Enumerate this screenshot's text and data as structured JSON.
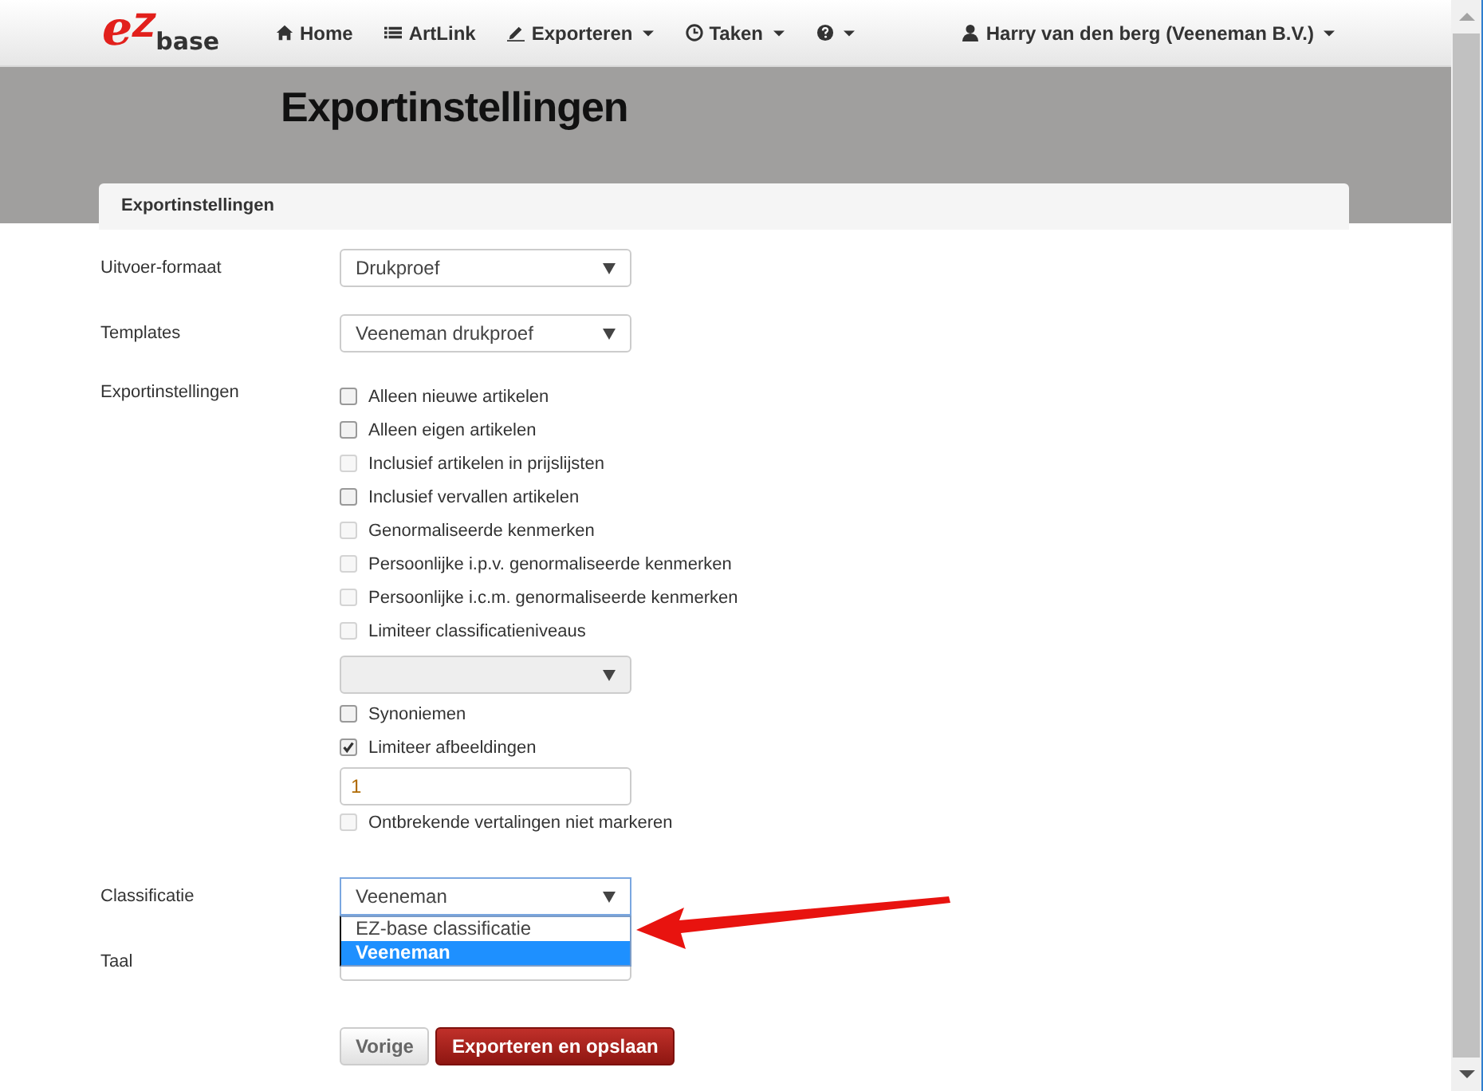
{
  "navbar": {
    "logo": {
      "letter_1": "e",
      "letter_2": "Z",
      "word": "base"
    },
    "items": [
      {
        "label": "Home",
        "dropdown": false
      },
      {
        "label": "ArtLink",
        "dropdown": false
      },
      {
        "label": "Exporteren",
        "dropdown": true
      },
      {
        "label": "Taken",
        "dropdown": true
      },
      {
        "dropdown": true
      }
    ],
    "user": {
      "label": "Harry van den berg (Veeneman B.V.)",
      "dropdown": true
    }
  },
  "page_title": "Exportinstellingen",
  "panel": {
    "heading": "Exportinstellingen",
    "fields": [
      {
        "kind": "select",
        "label": "Uitvoer-formaat",
        "value": "Drukproef"
      },
      {
        "kind": "select",
        "label": "Templates",
        "value": "Veeneman drukproef"
      },
      {
        "kind": "group",
        "label": "Exportinstellingen",
        "items": [
          {
            "kind": "checkbox",
            "label": "Alleen nieuwe artikelen",
            "checked": false,
            "disabled": false
          },
          {
            "kind": "checkbox",
            "label": "Alleen eigen artikelen",
            "checked": false,
            "disabled": false
          },
          {
            "kind": "checkbox",
            "label": "Inclusief artikelen in prijslijsten",
            "checked": false,
            "disabled": true
          },
          {
            "kind": "checkbox",
            "label": "Inclusief vervallen artikelen",
            "checked": false,
            "disabled": false
          },
          {
            "kind": "checkbox",
            "label": "Genormaliseerde kenmerken",
            "checked": false,
            "disabled": true
          },
          {
            "kind": "checkbox",
            "label": "Persoonlijke i.p.v. genormaliseerde kenmerken",
            "checked": false,
            "disabled": true
          },
          {
            "kind": "checkbox",
            "label": "Persoonlijke i.c.m. genormaliseerde kenmerken",
            "checked": false,
            "disabled": true
          },
          {
            "kind": "checkbox",
            "label": "Limiteer classificatieniveaus",
            "checked": false,
            "disabled": true
          },
          {
            "kind": "select",
            "disabled": true
          },
          {
            "kind": "checkbox",
            "label": "Synoniemen",
            "checked": false,
            "disabled": false
          },
          {
            "kind": "checkbox",
            "label": "Limiteer afbeeldingen",
            "checked": true,
            "disabled": false
          },
          {
            "kind": "text",
            "value": "1"
          },
          {
            "kind": "checkbox",
            "label": "Ontbrekende vertalingen niet markeren",
            "checked": false,
            "disabled": true
          }
        ]
      },
      {
        "kind": "select",
        "label": "Classificatie",
        "value": "Veeneman",
        "open": true,
        "options": [
          {
            "label": "EZ-base classificatie",
            "selected": false
          },
          {
            "label": "Veeneman",
            "selected": true
          }
        ]
      },
      {
        "kind": "select",
        "label": "Taal"
      }
    ],
    "buttons": [
      {
        "kind": "default",
        "label": "Vorige"
      },
      {
        "kind": "primary",
        "label": "Exporteren en opslaan"
      }
    ]
  }
}
